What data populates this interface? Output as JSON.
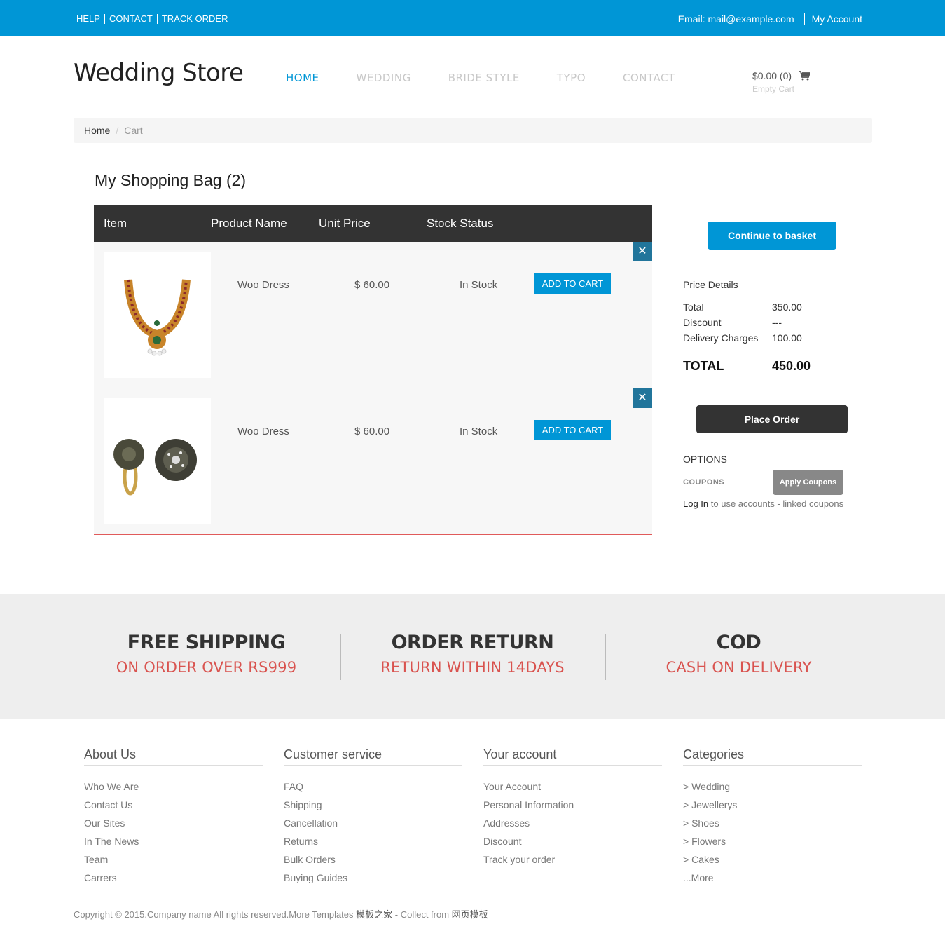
{
  "topbar": {
    "links": [
      "HELP",
      "CONTACT",
      "TRACK ORDER"
    ],
    "email": "Email: mail@example.com",
    "account": "My Account"
  },
  "header": {
    "logo": "Wedding Store",
    "nav": [
      "HOME",
      "WEDDING",
      "BRIDE STYLE",
      "TYPO",
      "CONTACT"
    ],
    "cart_amount": "$0.00 (0)",
    "cart_status": "Empty Cart"
  },
  "breadcrumb": {
    "home": "Home",
    "current": "Cart"
  },
  "bag": {
    "title": "My Shopping Bag (2)",
    "columns": [
      "Item",
      "Product Name",
      "Unit Price",
      "Stock Status"
    ],
    "items": [
      {
        "name": "Woo Dress",
        "price": "$ 60.00",
        "stock": "In Stock",
        "button": "ADD TO CART"
      },
      {
        "name": "Woo Dress",
        "price": "$ 60.00",
        "stock": "In Stock",
        "button": "ADD TO CART"
      }
    ]
  },
  "summary": {
    "continue_button": "Continue to basket",
    "price_details_title": "Price Details",
    "rows": [
      {
        "label": "Total",
        "value": "350.00"
      },
      {
        "label": "Discount",
        "value": "---"
      },
      {
        "label": "Delivery Charges",
        "value": "100.00"
      }
    ],
    "total_label": "TOTAL",
    "total_value": "450.00",
    "place_order": "Place Order",
    "options_title": "OPTIONS",
    "coupons_label": "COUPONS",
    "apply_coupons": "Apply Coupons",
    "login_link": "Log In",
    "login_note": " to use accounts - linked coupons"
  },
  "features": [
    {
      "title": "FREE SHIPPING",
      "subtitle": "ON ORDER OVER RS999"
    },
    {
      "title": "ORDER RETURN",
      "subtitle": "RETURN WITHIN 14DAYS"
    },
    {
      "title": "COD",
      "subtitle": "CASH ON DELIVERY"
    }
  ],
  "footer": {
    "columns": [
      {
        "title": "About Us",
        "links": [
          "Who We Are",
          "Contact Us",
          "Our Sites",
          "In The News",
          "Team",
          "Carrers"
        ]
      },
      {
        "title": "Customer service",
        "links": [
          "FAQ",
          "Shipping",
          "Cancellation",
          "Returns",
          "Bulk Orders",
          "Buying Guides"
        ]
      },
      {
        "title": "Your account",
        "links": [
          "Your Account",
          "Personal Information",
          "Addresses",
          "Discount",
          "Track your order"
        ]
      },
      {
        "title": "Categories",
        "links": [
          "> Wedding",
          "> Jewellerys",
          "> Shoes",
          "> Flowers",
          "> Cakes",
          "...More"
        ]
      }
    ],
    "copyright": "Copyright © 2015.Company name All rights reserved.More Templates ",
    "copyright_cn1": "模板之家",
    "copyright_mid": " - Collect from ",
    "copyright_cn2": "网页模板"
  },
  "colors": {
    "brand": "#0096d6",
    "dark": "#333333",
    "accent_red": "#d9534f"
  }
}
